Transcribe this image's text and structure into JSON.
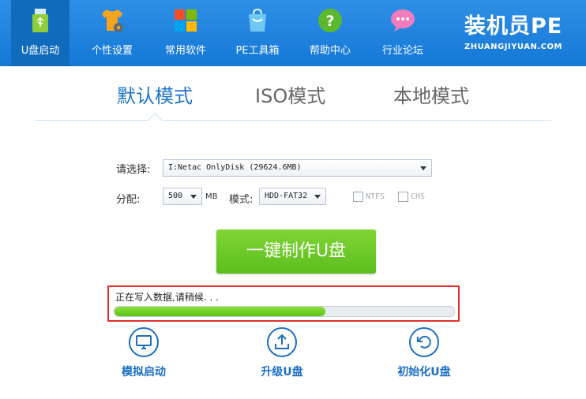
{
  "nav": {
    "items": [
      {
        "label": "U盘启动",
        "icon": "usb-drive-icon"
      },
      {
        "label": "个性设置",
        "icon": "tshirt-gear-icon"
      },
      {
        "label": "常用软件",
        "icon": "windows-tiles-icon"
      },
      {
        "label": "PE工具箱",
        "icon": "toolbox-icon"
      },
      {
        "label": "帮助中心",
        "icon": "help-icon"
      },
      {
        "label": "行业论坛",
        "icon": "chat-bubbles-icon"
      }
    ],
    "active_index": 0
  },
  "brand": {
    "name": "装机员PE",
    "url": "ZHUANGJIYUAN.COM"
  },
  "tabs": [
    {
      "label": "默认模式"
    },
    {
      "label": "ISO模式"
    },
    {
      "label": "本地模式"
    }
  ],
  "form": {
    "select_label": "请选择:",
    "disk_value": "I:Netac OnlyDisk (29624.6MB)",
    "alloc_label": "分配:",
    "alloc_value": "500",
    "alloc_unit": "MB",
    "mode_label": "模式:",
    "mode_value": "HDD-FAT32",
    "ntfs_label": "NTFS",
    "chs_label": "CHS"
  },
  "make_button": "一键制作U盘",
  "progress": {
    "text": "正在写入数据,请稍候. . .",
    "percent": 62
  },
  "actions": [
    {
      "label": "模拟启动",
      "icon": "monitor-icon"
    },
    {
      "label": "升级U盘",
      "icon": "upload-icon"
    },
    {
      "label": "初始化U盘",
      "icon": "reset-icon"
    }
  ],
  "colors": {
    "header": "#1478d6",
    "accent": "#1d73c6",
    "button": "#6ccb28",
    "progress": "#6fd12a",
    "highlight": "#e0302d"
  }
}
